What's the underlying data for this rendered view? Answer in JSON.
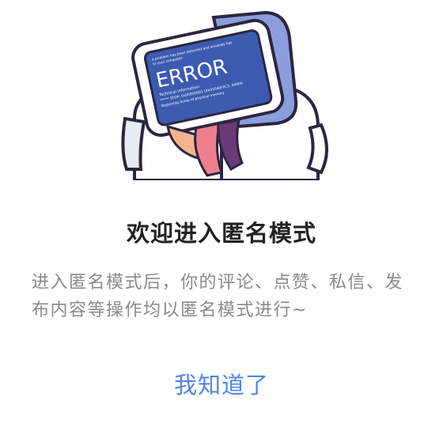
{
  "dialog": {
    "title": "欢迎进入匿名模式",
    "message": "进入匿名模式后，你的评论、点赞、私信、发布内容等操作均以匿名模式进行~",
    "confirm_label": "我知道了"
  },
  "illustration": {
    "icon": "error-computer-icon",
    "screen_heading": "ERROR",
    "screen_lines": [
      "a problem has been detected and windows has",
      "to your computer",
      "Technical information:",
      "***** STOP: 0x000000D1 (0X43540F0C3, 0X000",
      "Beginning dump of physical memory"
    ],
    "colors": {
      "screen": "#3c5bb0",
      "monitor": "#8b9ddc",
      "outline": "#2d2540",
      "ribbon_pink": "#f07f8e",
      "ribbon_peach": "#f3b48e",
      "ribbon_purple": "#6a3a78"
    }
  }
}
